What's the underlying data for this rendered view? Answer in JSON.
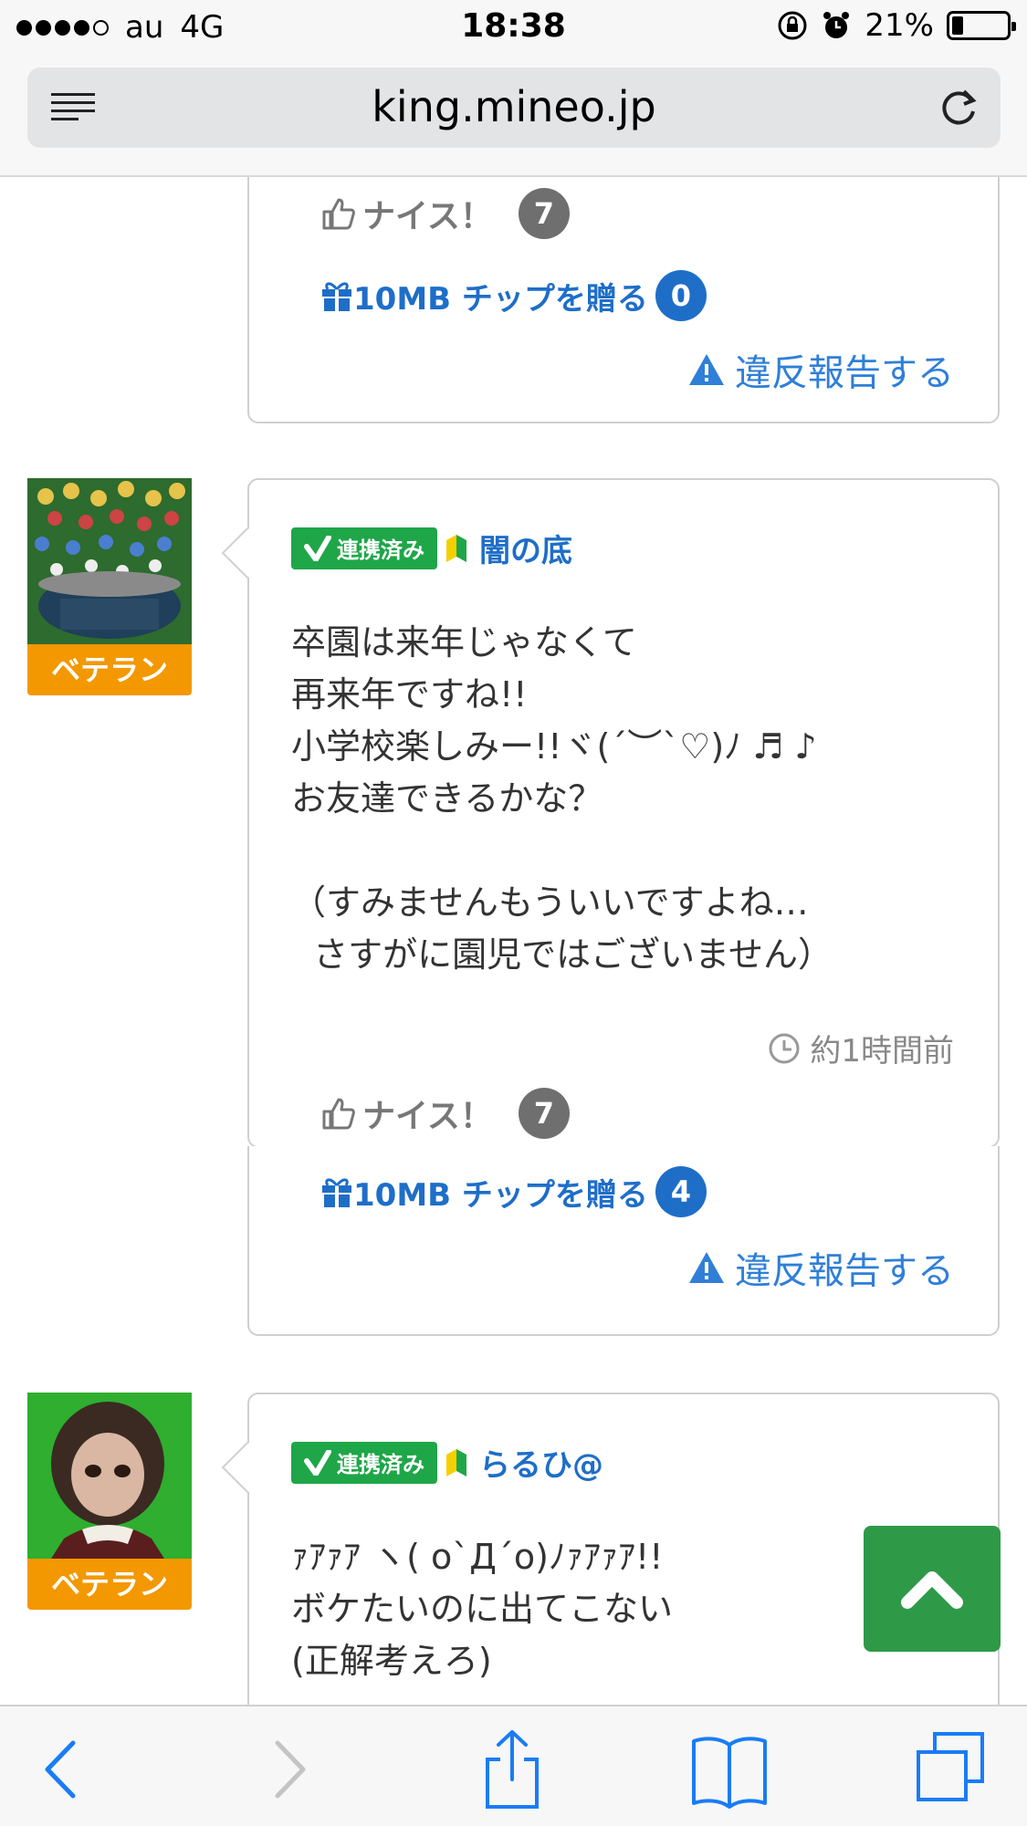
{
  "status_bar": {
    "carrier": "au",
    "network": "4G",
    "time": "18:38",
    "battery": "21%",
    "battery_level": 0.21
  },
  "browser": {
    "url": "king.mineo.jp"
  },
  "posts": [
    {
      "nice_label": "ナイス！",
      "nice_count": "7",
      "tip_label": "10MB チップを贈る",
      "tip_count": "0",
      "report_label": "違反報告する"
    },
    {
      "avatar_label": "ベテラン",
      "badge": "連携済み",
      "user_name": "闇の底",
      "body": "卒園は来年じゃなくて\n再来年ですね!!\n小学校楽しみー!!ヾ(´︶`♡)ﾉ ♬ ♪\nお友達できるかな？\n\n（すみませんもういいですよね…\n  さすがに園児ではございません）",
      "timestamp": "約1時間前",
      "nice_label": "ナイス！",
      "nice_count": "7",
      "tip_label": "10MB チップを贈る",
      "tip_count": "4",
      "report_label": "違反報告する"
    },
    {
      "avatar_label": "ベテラン",
      "badge": "連携済み",
      "user_name": "らるひ@",
      "body": "ｧｱｧｱ ヽ( o`Д´o)ﾉｧｱｧｱ!!\nボケたいのに出てこない\n(正解考えろ)"
    }
  ],
  "colors": {
    "link_blue": "#1e6ec8",
    "badge_green": "#1fa649",
    "veteran_orange": "#f39800",
    "scroll_top_green": "#2e9a48",
    "ios_blue": "#1a7cf5"
  },
  "icons": {
    "thumbs_up": "thumbs-up-icon",
    "gift": "gift-icon",
    "warning": "warning-icon",
    "clock": "clock-icon",
    "beginner": "beginner-mark-icon",
    "scroll_top": "chevron-up-icon"
  }
}
